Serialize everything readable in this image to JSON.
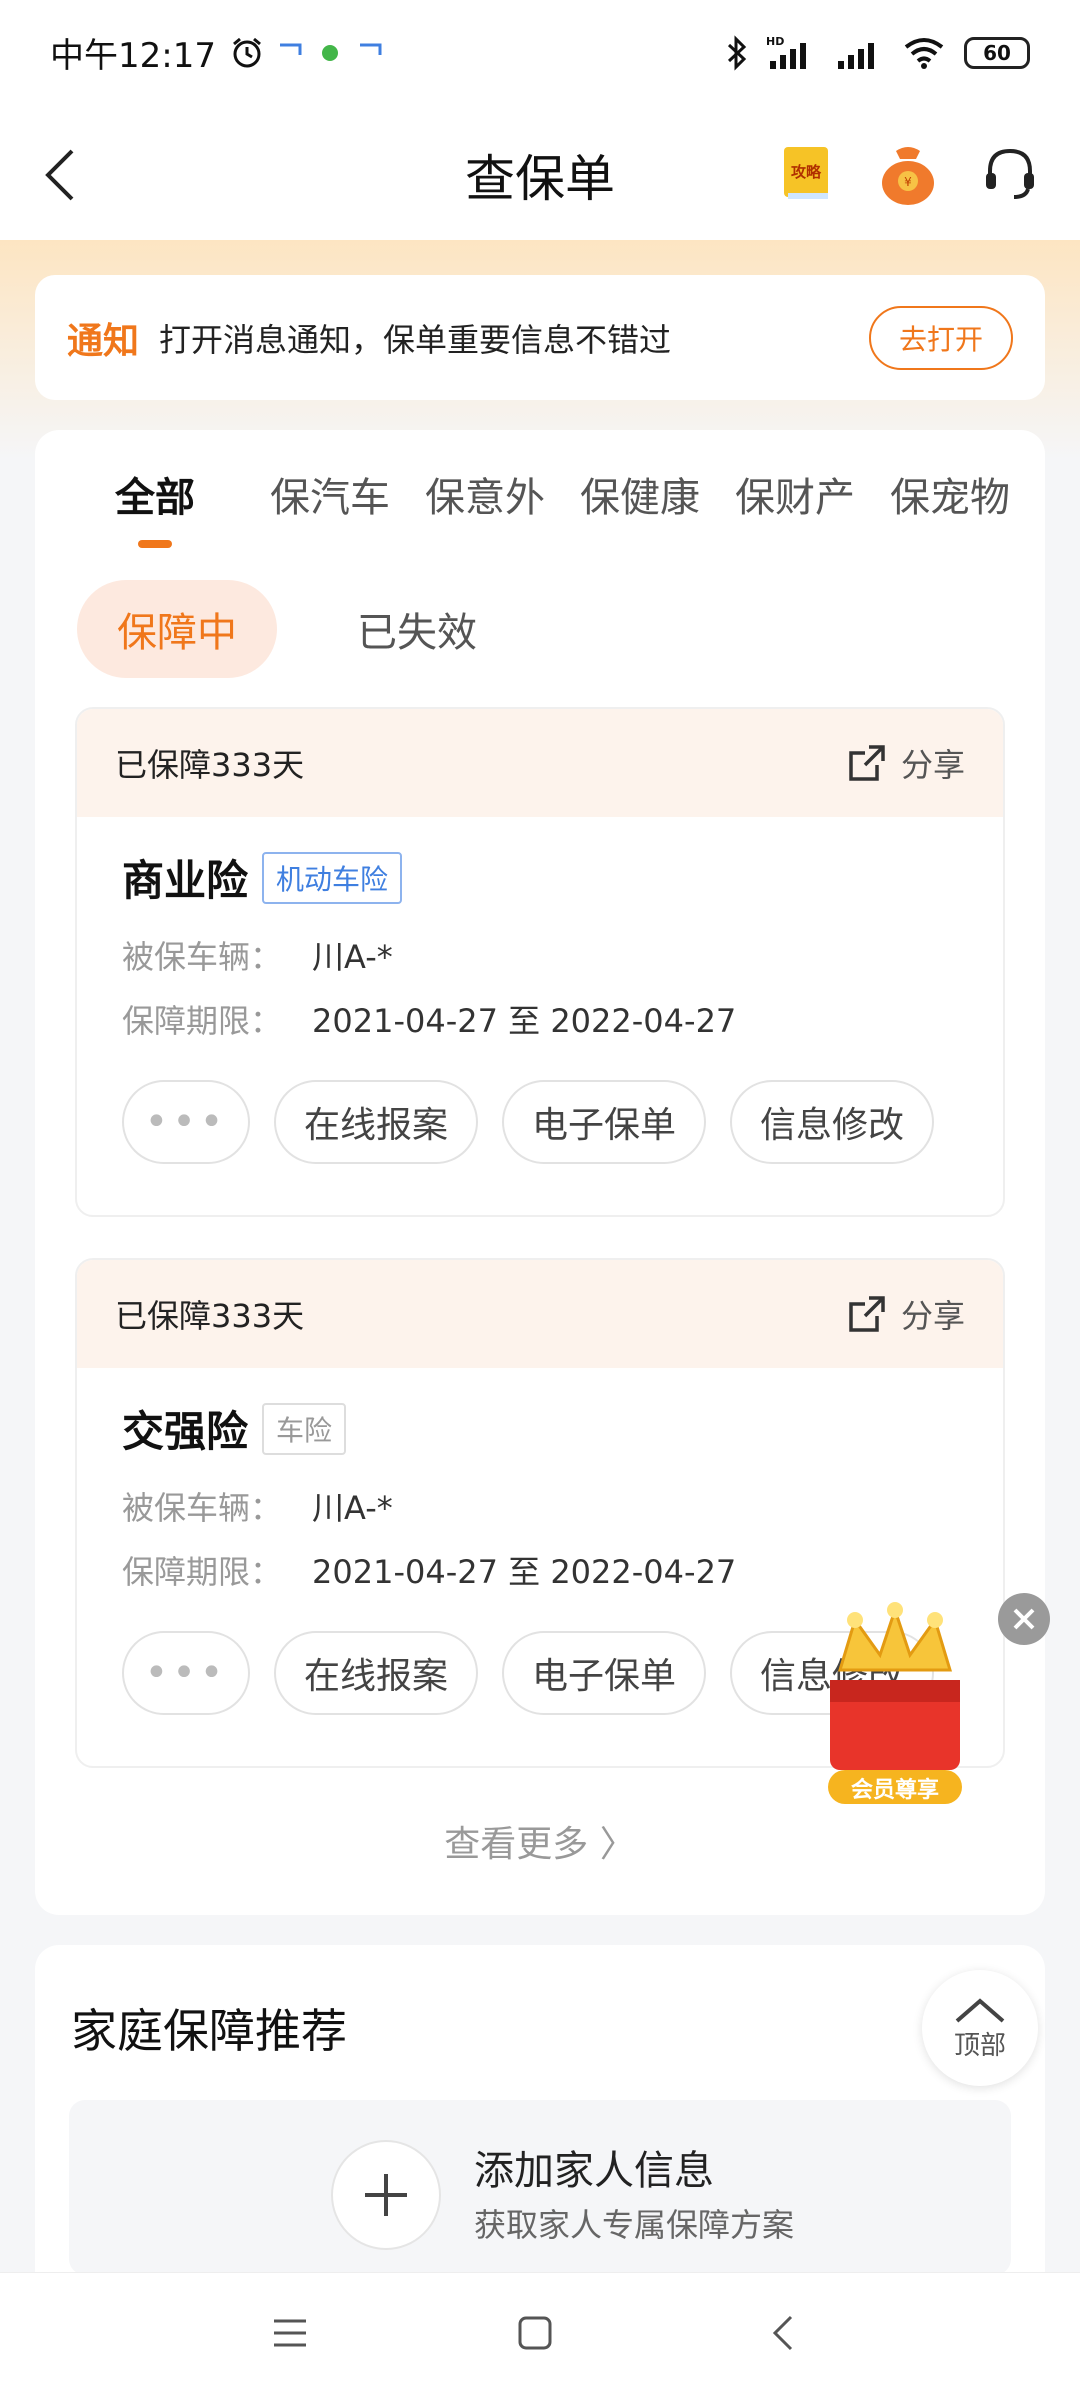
{
  "status_bar": {
    "time": "中午12:17",
    "battery": "60",
    "hd_label": "HD"
  },
  "header": {
    "title": "查保单",
    "guide_icon_text": "攻略"
  },
  "notice": {
    "tag": "通知",
    "text": "打开消息通知，保单重要信息不错过",
    "button": "去打开"
  },
  "tabs": [
    "全部",
    "保汽车",
    "保意外",
    "保健康",
    "保财产",
    "保宠物"
  ],
  "sub_tabs": [
    "保障中",
    "已失效"
  ],
  "policies": [
    {
      "days": "已保障333天",
      "share": "分享",
      "name": "商业险",
      "tag": "机动车险",
      "vehicle_label": "被保车辆：",
      "vehicle": "川A-*",
      "period_label": "保障期限：",
      "period": "2021-04-27 至 2022-04-27",
      "more": "•••",
      "actions": [
        "在线报案",
        "电子保单",
        "信息修改"
      ]
    },
    {
      "days": "已保障333天",
      "share": "分享",
      "name": "交强险",
      "tag": "车险",
      "vehicle_label": "被保车辆：",
      "vehicle": "川A-*",
      "period_label": "保障期限：",
      "period": "2021-04-27 至 2022-04-27",
      "more": "•••",
      "actions": [
        "在线报案",
        "电子保单",
        "信息修改"
      ]
    }
  ],
  "see_more": "查看更多 〉",
  "vip_badge": "会员尊享",
  "top_button": "顶部",
  "family": {
    "title": "家庭保障推荐",
    "add": "添加家人信息",
    "sub": "获取家人专属保障方案"
  },
  "colors": {
    "accent": "#f0771b",
    "tag_blue": "#3f7fe0"
  }
}
